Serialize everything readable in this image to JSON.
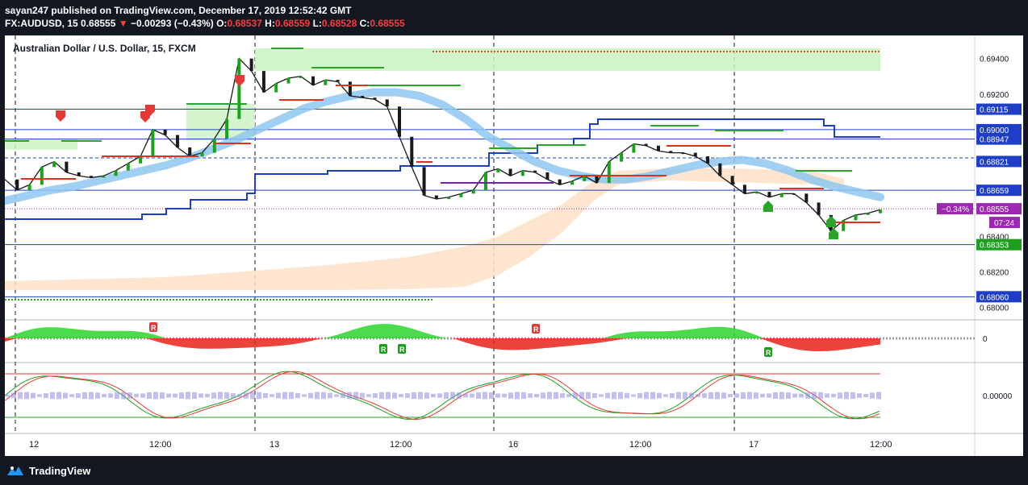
{
  "header": {
    "line1": "sayan247 published on TradingView.com, December 17, 2019 12:52:42 GMT",
    "symbol": "FX:AUDUSD, 15",
    "price": "0.68555",
    "change": "−0.00293 (−0.43%)",
    "o_label": "O:",
    "o_value": "0.68537",
    "h_label": "H:",
    "h_value": "0.68559",
    "l_label": "L:",
    "l_value": "0.68528",
    "c_label": "C:",
    "c_value": "0.68555"
  },
  "footer": {
    "brand": "TradingView"
  },
  "colors": {
    "background": "#131722",
    "blue_line": "#1f3ec8",
    "ma_band": "#8ec7f0",
    "green_zone": "#c9f2c2",
    "orange_cloud": "#fde0c8",
    "purple_tag": "#9c27b0",
    "green_tag": "#1e9e1e",
    "blue_tag": "#1f3ec8"
  },
  "chart_data": {
    "type": "line",
    "title": "Australian Dollar / U.S. Dollar, 15, FXCM",
    "y_ticks": [
      "0.69400",
      "0.69200",
      "0.68400",
      "0.68200",
      "0.68000"
    ],
    "y_range": [
      0.6793,
      0.6953
    ],
    "x_ticks": [
      "12",
      "12:00",
      "13",
      "12:00",
      "16",
      "12:00",
      "17",
      "12:00"
    ],
    "price_tags": [
      {
        "label": "0.69115",
        "value": 0.69115,
        "color": "#1f3ec8"
      },
      {
        "label": "0.69000",
        "value": 0.69,
        "color": "#1f3ec8"
      },
      {
        "label": "0.68947",
        "value": 0.68947,
        "color": "#1f3ec8"
      },
      {
        "label": "0.68821",
        "value": 0.68821,
        "color": "#1f3ec8"
      },
      {
        "label": "0.68659",
        "value": 0.68659,
        "color": "#1f3ec8"
      },
      {
        "label": "0.68555",
        "value": 0.68555,
        "color": "#9c27b0"
      },
      {
        "label": "0.68353",
        "value": 0.68353,
        "color": "#1e9e1e"
      },
      {
        "label": "0.68060",
        "value": 0.6806,
        "color": "#1f3ec8"
      }
    ],
    "change_tag": "−0.34%",
    "countdown": "07:24",
    "horizontal_levels": [
      0.69115,
      0.69,
      0.68947,
      0.68841,
      0.68659,
      0.68353,
      0.6806
    ],
    "close_series": [
      0.6872,
      0.6866,
      0.6869,
      0.6879,
      0.6882,
      0.6876,
      0.6874,
      0.6873,
      0.6874,
      0.6877,
      0.6881,
      0.6885,
      0.69,
      0.6897,
      0.689,
      0.6885,
      0.6887,
      0.6895,
      0.6906,
      0.694,
      0.6933,
      0.6921,
      0.6926,
      0.6929,
      0.693,
      0.6925,
      0.6928,
      0.6927,
      0.6919,
      0.6918,
      0.6917,
      0.6913,
      0.6896,
      0.6879,
      0.6863,
      0.6861,
      0.6862,
      0.6864,
      0.6866,
      0.6876,
      0.6878,
      0.6874,
      0.6877,
      0.6876,
      0.6872,
      0.6869,
      0.6871,
      0.6874,
      0.687,
      0.6882,
      0.6887,
      0.6892,
      0.6891,
      0.6888,
      0.6887,
      0.6887,
      0.6885,
      0.6881,
      0.6874,
      0.6869,
      0.6864,
      0.6865,
      0.6862,
      0.6864,
      0.6864,
      0.6859,
      0.6852,
      0.6843,
      0.6849,
      0.6852,
      0.6853,
      0.6855
    ],
    "ma_series": [
      0.686,
      0.6863,
      0.6866,
      0.6868,
      0.6871,
      0.6874,
      0.6877,
      0.688,
      0.6884,
      0.6889,
      0.6894,
      0.69,
      0.6906,
      0.6912,
      0.6916,
      0.6919,
      0.6921,
      0.6921,
      0.6919,
      0.6914,
      0.6906,
      0.6896,
      0.6889,
      0.6882,
      0.6877,
      0.6874,
      0.6872,
      0.6872,
      0.6874,
      0.6877,
      0.688,
      0.6882,
      0.6883,
      0.6881,
      0.6877,
      0.6872,
      0.6868,
      0.6865,
      0.6862
    ],
    "oscillator_zero_label": "0",
    "stoch_zero_label": "0.00000"
  }
}
